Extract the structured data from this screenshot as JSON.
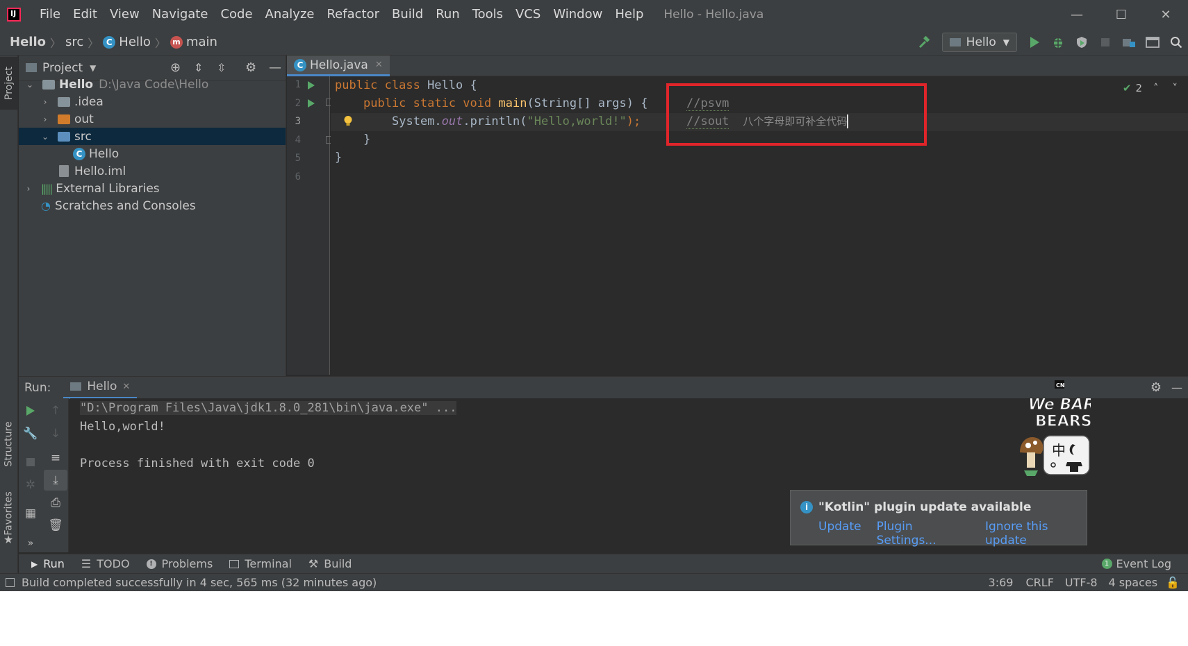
{
  "window": {
    "title": "Hello - Hello.java",
    "minimize_glyph": "—",
    "maximize_glyph": "☐",
    "close_glyph": "✕"
  },
  "menu": [
    "File",
    "Edit",
    "View",
    "Navigate",
    "Code",
    "Analyze",
    "Refactor",
    "Build",
    "Run",
    "Tools",
    "VCS",
    "Window",
    "Help"
  ],
  "breadcrumb": {
    "project": "Hello",
    "folder": "src",
    "class": "Hello",
    "method": "main"
  },
  "toolbar": {
    "run_config": "Hello",
    "icons": [
      "hammer-icon",
      "run-icon",
      "debug-icon",
      "coverage-icon",
      "stop-icon",
      "project-structure-icon",
      "layout-icon",
      "search-icon"
    ]
  },
  "left_strip": {
    "project_tab": "Project",
    "structure_tab": "Structure",
    "favorites_tab": "Favorites"
  },
  "project_panel": {
    "title": "Project",
    "tree": {
      "root_name": "Hello",
      "root_path": "D:\\Java Code\\Hello",
      "idea": ".idea",
      "out": "out",
      "src": "src",
      "hello_class": "Hello",
      "hello_iml": "Hello.iml",
      "external_libraries": "External Libraries",
      "scratches": "Scratches and Consoles"
    }
  },
  "editor": {
    "tab_label": "Hello.java",
    "line_numbers": [
      "1",
      "2",
      "3",
      "4",
      "5",
      "6"
    ],
    "inspection_count": "2",
    "code": {
      "l1_kw": "public class",
      "l1_name": " Hello {",
      "l2_kw": "public static void",
      "l2_fn": "main",
      "l2_rest": "(String[] args) {",
      "l3_a": "System.",
      "l3_field": "out",
      "l3_b": ".println(",
      "l3_str": "\"Hello,world!\"",
      "l3_c": ");",
      "l4": "}",
      "l5": "}"
    },
    "annotation": {
      "comment1": "//psvm",
      "comment2": "//sout",
      "note": "八个字母即可补全代码"
    }
  },
  "run_panel": {
    "label": "Run:",
    "tab": "Hello",
    "console": {
      "command": "\"D:\\Program Files\\Java\\jdk1.8.0_281\\bin\\java.exe\" ...",
      "output": "Hello,world!",
      "exit": "Process finished with exit code 0"
    }
  },
  "notification": {
    "title": "\"Kotlin\" plugin update available",
    "update": "Update",
    "settings": "Plugin Settings...",
    "ignore": "Ignore this update"
  },
  "tool_tabs": {
    "run": "Run",
    "todo": "TODO",
    "problems": "Problems",
    "terminal": "Terminal",
    "build": "Build",
    "event_log": "Event Log",
    "event_count": "1"
  },
  "status": {
    "message": "Build completed successfully in 4 sec, 565 ms (32 minutes ago)",
    "position": "3:69",
    "line_sep": "CRLF",
    "encoding": "UTF-8",
    "indent": "4 spaces"
  },
  "sticker": {
    "text1": "We BARE",
    "text2": "BEARS",
    "badge": "CN",
    "ime": "中"
  },
  "colors": {
    "keyword": "#cc7832",
    "string": "#6a8759",
    "function": "#ffc66d",
    "highlight_box": "#e0252a",
    "link": "#589df6"
  }
}
